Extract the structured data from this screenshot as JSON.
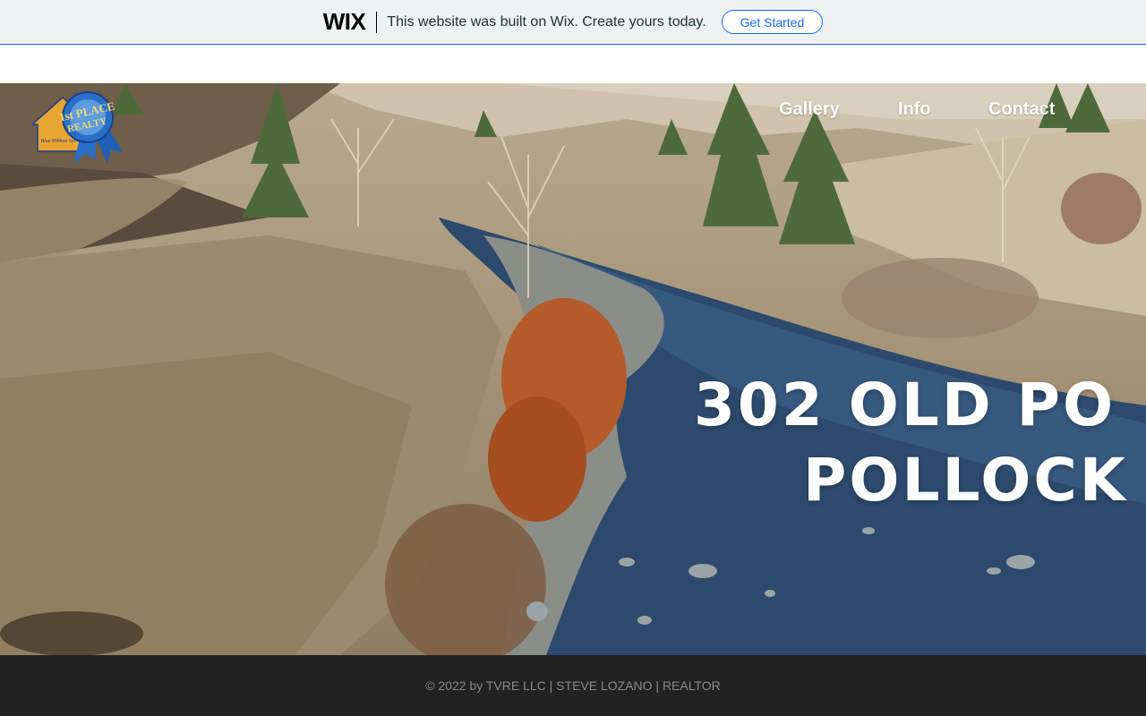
{
  "wix_banner": {
    "logo": "WIX",
    "message": "This website was built on Wix. Create yours today.",
    "cta_label": "Get Started"
  },
  "header": {
    "logo_text": "1st PLACE REALTY",
    "logo_tagline": "Blue Ribbon Service",
    "nav": {
      "gallery": "Gallery",
      "info": "Info",
      "contact": "Contact"
    }
  },
  "hero": {
    "title_line1": "302 OLD PO",
    "title_line2": "POLLOCK"
  },
  "footer": {
    "text": "© 2022 by TVRE LLC | STEVE LOZANO | REALTOR"
  },
  "colors": {
    "wix_accent": "#116dff",
    "footer_bg": "#212121",
    "banner_bg": "#eff1f2"
  }
}
